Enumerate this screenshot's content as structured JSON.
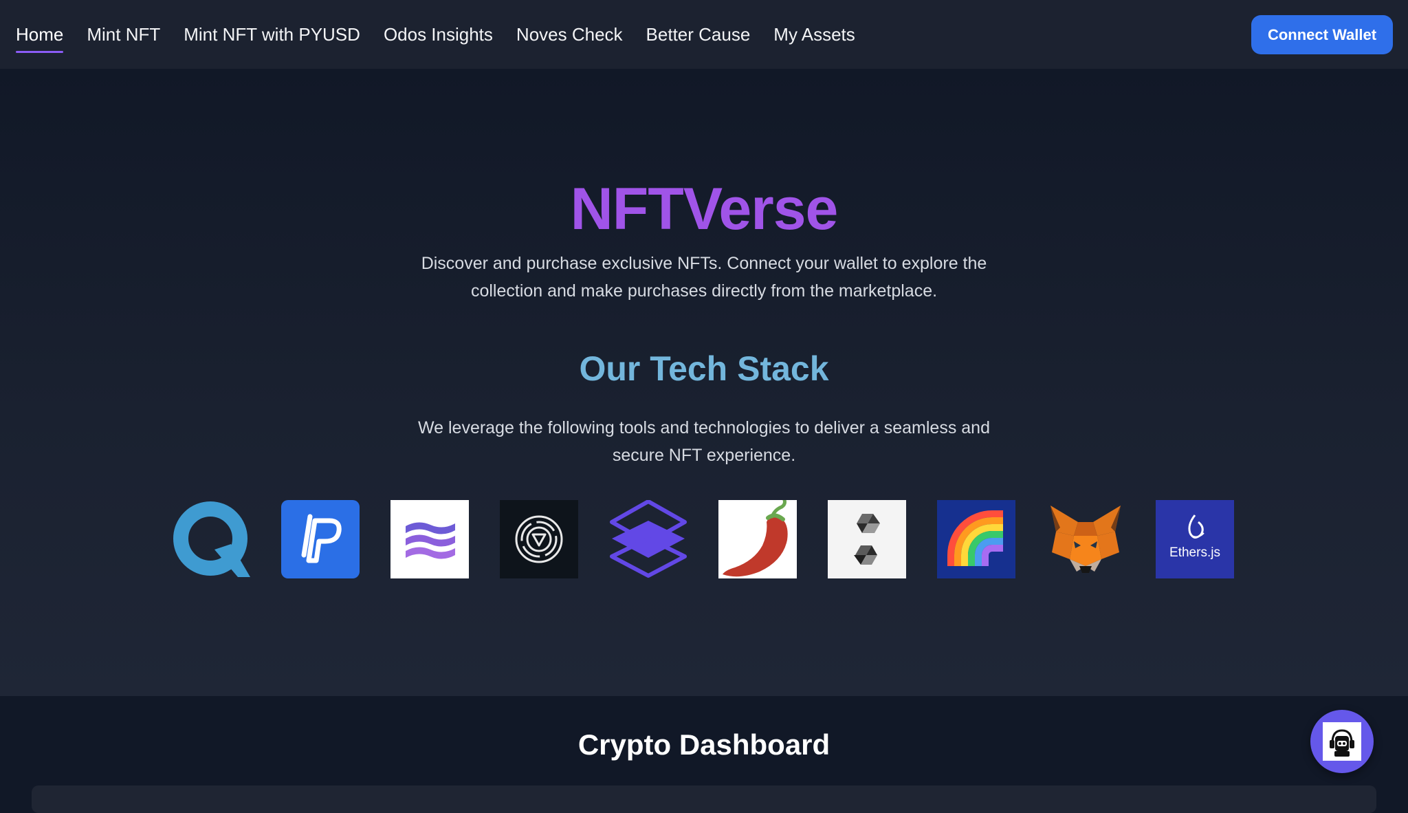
{
  "nav": {
    "items": [
      {
        "label": "Home",
        "active": true
      },
      {
        "label": "Mint NFT"
      },
      {
        "label": "Mint NFT with PYUSD"
      },
      {
        "label": "Odos Insights"
      },
      {
        "label": "Noves Check"
      },
      {
        "label": "Better Cause"
      },
      {
        "label": "My Assets"
      }
    ],
    "connect_label": "Connect Wallet"
  },
  "hero": {
    "title": "NFTVerse",
    "description": "Discover and purchase exclusive NFTs. Connect your wallet to explore the collection and make purchases directly from the marketplace."
  },
  "tech_stack": {
    "title": "Our Tech Stack",
    "description": "We leverage the following tools and technologies to deliver a seamless and secure NFT experience.",
    "logos": [
      {
        "icon": "quicknode-logo-icon"
      },
      {
        "icon": "paypal-pyusd-logo-icon"
      },
      {
        "icon": "wave-stripes-logo-icon"
      },
      {
        "icon": "circular-v-logo-icon"
      },
      {
        "icon": "purple-layers-logo-icon"
      },
      {
        "icon": "chili-pepper-logo-icon"
      },
      {
        "icon": "solidity-logo-icon"
      },
      {
        "icon": "rainbow-logo-icon"
      },
      {
        "icon": "metamask-fox-logo-icon"
      },
      {
        "icon": "ethersjs-logo-icon",
        "text": "Ethers.js"
      }
    ]
  },
  "dashboard": {
    "title": "Crypto Dashboard"
  },
  "colors": {
    "accent_purple": "#a054e8",
    "accent_blue": "#73b6dc",
    "button_blue": "#2f6fea",
    "chat_fab": "#6558ea"
  }
}
